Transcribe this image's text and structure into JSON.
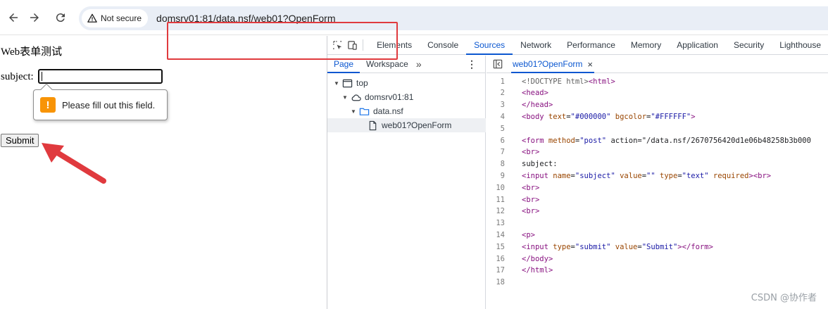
{
  "browser": {
    "security_label": "Not secure",
    "url": "domsrv01:81/data.nsf/web01?OpenForm"
  },
  "page": {
    "heading": "Web表单测试",
    "subject_label": "subject:",
    "subject_value": "",
    "validation_message": "Please fill out this field.",
    "warning_glyph": "!",
    "submit_label": "Submit"
  },
  "devtools": {
    "tabs": [
      "Elements",
      "Console",
      "Sources",
      "Network",
      "Performance",
      "Memory",
      "Application",
      "Security",
      "Lighthouse"
    ],
    "active_tab": "Sources",
    "navigator": {
      "tabs": [
        "Page",
        "Workspace"
      ],
      "active_tab": "Page",
      "more_glyph": "»",
      "tree": [
        {
          "label": "top",
          "icon": "frame-icon"
        },
        {
          "label": "domsrv01:81",
          "icon": "cloud-icon"
        },
        {
          "label": "data.nsf",
          "icon": "folder-icon"
        },
        {
          "label": "web01?OpenForm",
          "icon": "file-icon",
          "selected": true
        }
      ]
    },
    "editor": {
      "file_tab": "web01?OpenForm",
      "close_glyph": "×",
      "lines": [
        "<!DOCTYPE html><html>",
        "<head>",
        "</head>",
        "<body text=\"#000000\" bgcolor=\"#FFFFFF\">",
        "",
        "<form method=\"post\" action=\"/data.nsf/2670756420d1e06b48258b3b000",
        "<br>",
        "subject:",
        "<input name=\"subject\" value=\"\" type=\"text\" required><br>",
        "<br>",
        "<br>",
        "<br>",
        "",
        "<p>",
        "<input type=\"submit\" value=\"Submit\"></form>",
        "</body>",
        "</html>",
        ""
      ]
    }
  },
  "watermark": "CSDN @协作者",
  "colors": {
    "accent": "#0b57d0",
    "annotation_red": "#e03a3e",
    "warning_orange": "#f89406"
  }
}
